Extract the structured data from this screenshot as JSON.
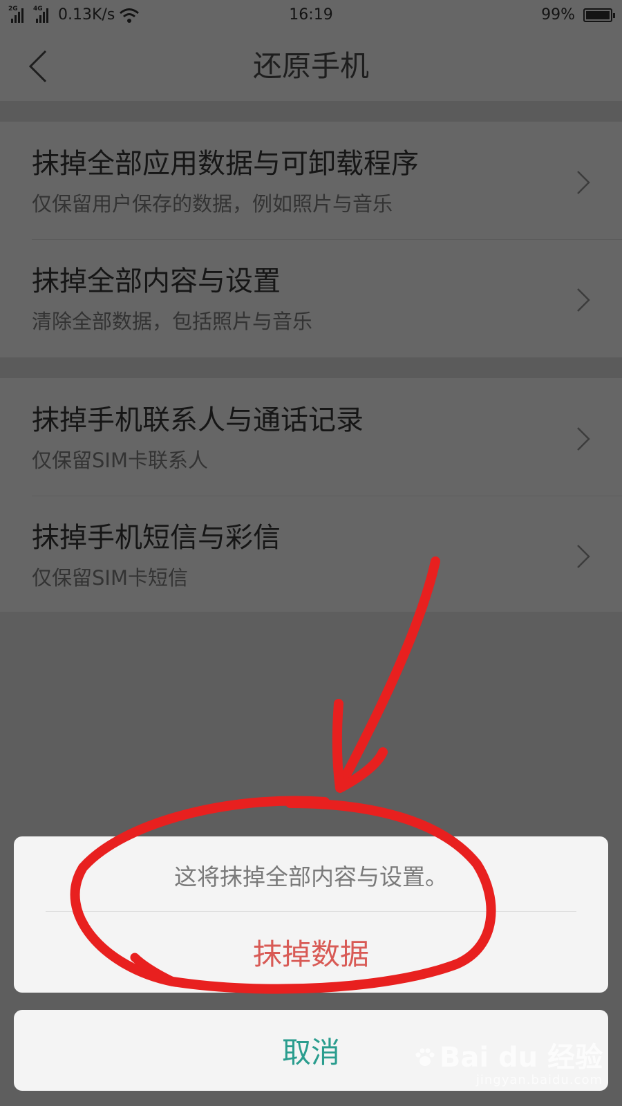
{
  "status_bar": {
    "sim1_label": "2G",
    "sim2_label": "4G",
    "network_speed": "0.13K/s",
    "time": "16:19",
    "battery_text": "99%",
    "battery_level": 0.99
  },
  "header": {
    "title": "还原手机"
  },
  "options": [
    {
      "title": "抹掉全部应用数据与可卸载程序",
      "subtitle": "仅保留用户保存的数据，例如照片与音乐"
    },
    {
      "title": "抹掉全部内容与设置",
      "subtitle": "清除全部数据，包括照片与音乐"
    },
    {
      "title": "抹掉手机联系人与通话记录",
      "subtitle": "仅保留SIM卡联系人"
    },
    {
      "title": "抹掉手机短信与彩信",
      "subtitle": "仅保留SIM卡短信"
    }
  ],
  "action_sheet": {
    "message": "这将抹掉全部内容与设置。",
    "confirm_label": "抹掉数据",
    "cancel_label": "取消"
  },
  "watermark": {
    "brand": "Bai du 经验",
    "site": "jingyan.baidu.com"
  },
  "colors": {
    "destructive": "#d85a55",
    "cancel": "#2a9d8e",
    "annotation": "#e8201f"
  },
  "icons": [
    "back-arrow-icon",
    "chevron-right-icon",
    "signal-icon",
    "wifi-icon",
    "battery-icon",
    "paw-logo-icon"
  ]
}
